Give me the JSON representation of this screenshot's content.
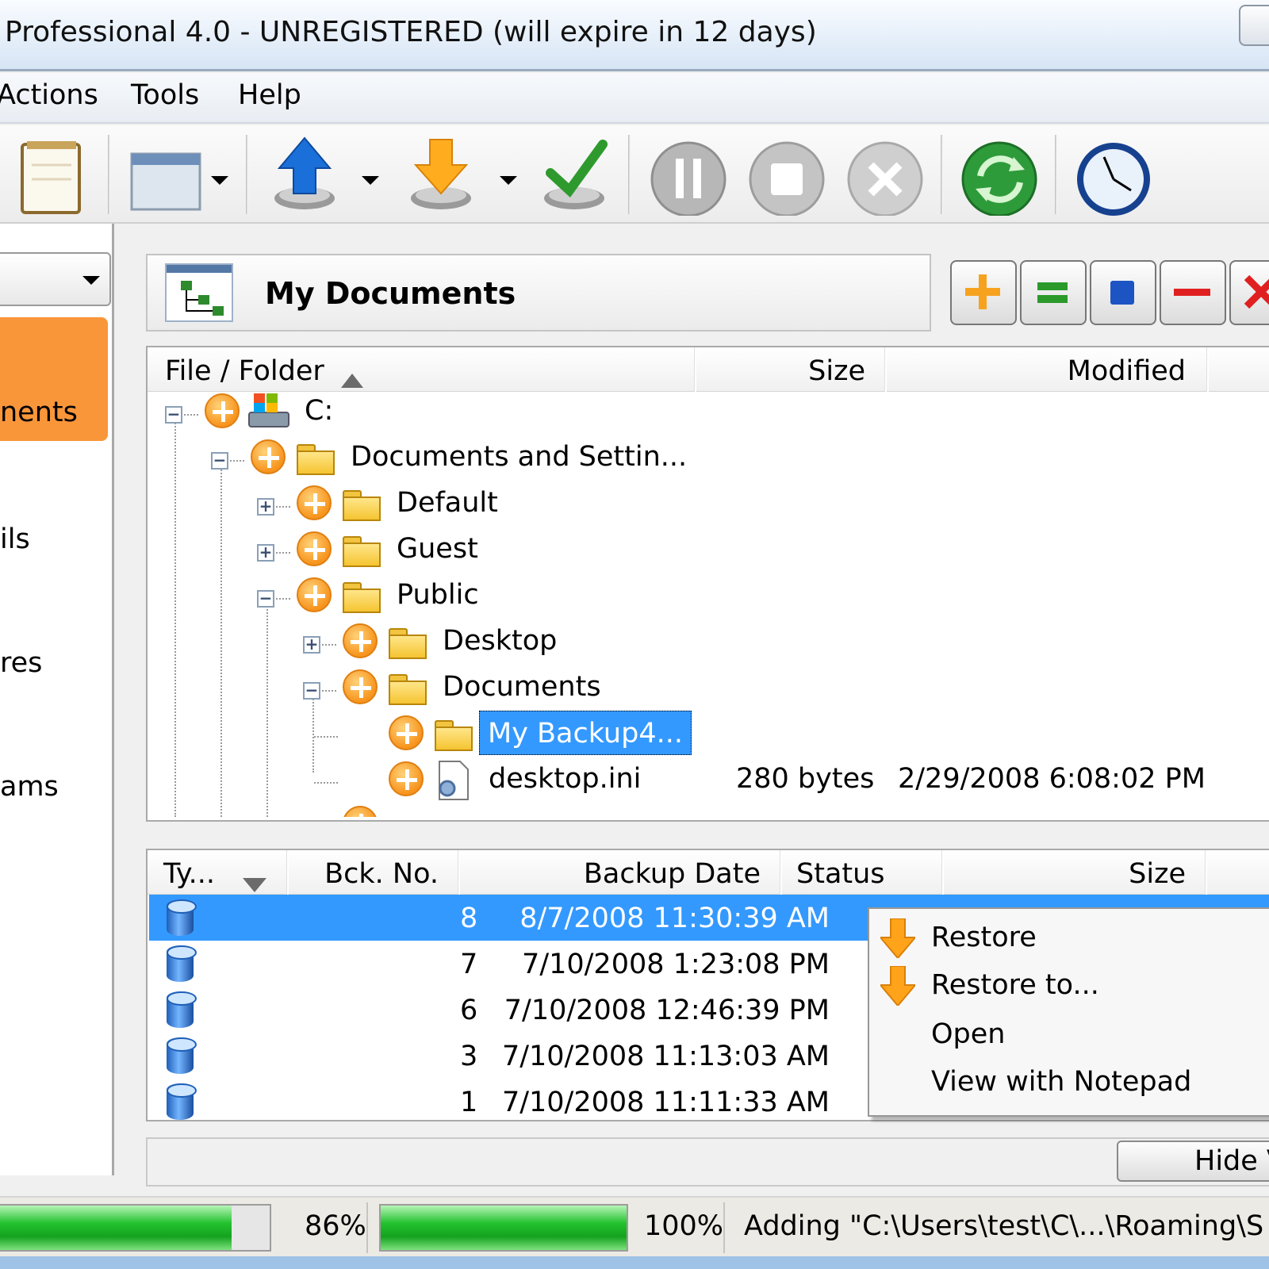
{
  "window": {
    "title": "Professional 4.0 - UNREGISTERED (will expire in 12 days)"
  },
  "menu": {
    "items": [
      {
        "label": "Actions"
      },
      {
        "label": "Tools"
      },
      {
        "label": "Help"
      }
    ]
  },
  "toolbar": {
    "icons": [
      "notepad-icon",
      "window-layout-icon",
      "backup-upload-icon",
      "restore-download-icon",
      "verify-check-icon",
      "pause-icon",
      "stop-icon",
      "cancel-icon",
      "refresh-icon",
      "schedule-clock-icon"
    ]
  },
  "left_panel": {
    "items": [
      {
        "label": "nents",
        "selected": true
      },
      {
        "label": "ils"
      },
      {
        "label": "res"
      },
      {
        "label": "ams"
      }
    ]
  },
  "header": {
    "title": "My Documents"
  },
  "tree": {
    "columns": [
      "File / Folder",
      "Size",
      "Modified"
    ],
    "rows": [
      {
        "name": "C:",
        "size": "",
        "modified": ""
      },
      {
        "name": "Documents and Settin...",
        "size": "",
        "modified": ""
      },
      {
        "name": "Default",
        "size": "",
        "modified": ""
      },
      {
        "name": "Guest",
        "size": "",
        "modified": ""
      },
      {
        "name": "Public",
        "size": "",
        "modified": ""
      },
      {
        "name": "Desktop",
        "size": "",
        "modified": ""
      },
      {
        "name": "Documents",
        "size": "",
        "modified": ""
      },
      {
        "name": "My Backup4...",
        "size": "",
        "modified": "",
        "selected": true
      },
      {
        "name": "desktop.ini",
        "size": "280 bytes",
        "modified": "2/29/2008 6:08:02 PM"
      }
    ]
  },
  "backups": {
    "columns": [
      "Ty...",
      "Bck. No.",
      "Backup Date",
      "Status",
      "Size"
    ],
    "rows": [
      {
        "no": "8",
        "date": "8/7/2008 11:30:39 AM",
        "selected": true
      },
      {
        "no": "7",
        "date": "7/10/2008 1:23:08 PM"
      },
      {
        "no": "6",
        "date": "7/10/2008 12:46:39 PM"
      },
      {
        "no": "3",
        "date": "7/10/2008 11:13:03 AM"
      },
      {
        "no": "1",
        "date": "7/10/2008 11:11:33 AM"
      }
    ]
  },
  "context_menu": {
    "items": [
      {
        "label": "Restore",
        "icon": "restore-arrow-icon"
      },
      {
        "label": "Restore to...",
        "icon": "restore-arrow-icon"
      },
      {
        "label": "Open"
      },
      {
        "label": "View with Notepad"
      }
    ]
  },
  "bottom": {
    "hide_label": "Hide V"
  },
  "status": {
    "progress1": {
      "value": 0.86,
      "label": "86%"
    },
    "progress2": {
      "value": 1.0,
      "label": "100%"
    },
    "message": "Adding \"C:\\Users\\test\\C\\...\\Roaming\\S"
  },
  "colors": {
    "accent_orange": "#f9963a",
    "selection_blue": "#3399ff",
    "progress_green": "#22c12e"
  }
}
